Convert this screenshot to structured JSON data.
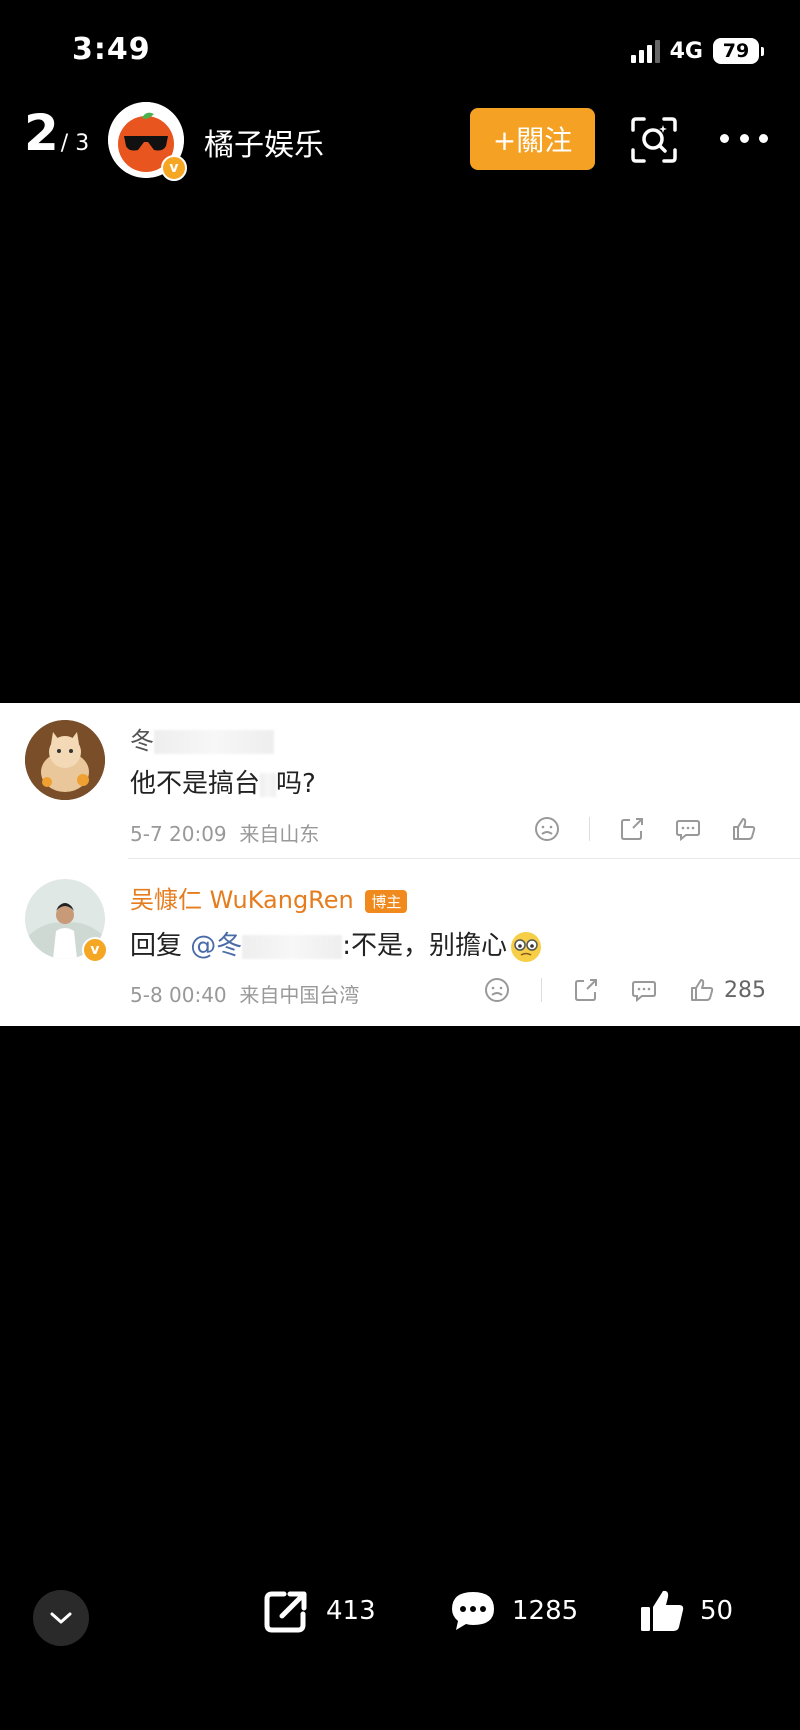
{
  "status": {
    "time": "3:49",
    "network": "4G",
    "battery": "79"
  },
  "header": {
    "page_current": "2",
    "page_total": "/ 3",
    "account_name": "橘子娱乐",
    "follow_label": "+關注",
    "verify_mark": "v"
  },
  "comment": {
    "user_name": "冬",
    "text_before": "他不是搞台",
    "text_after": "吗?",
    "time": "5-7 20:09",
    "location": "来自山东"
  },
  "reply": {
    "user_name": "吴慷仁 WuKangRen",
    "author_tag": "博主",
    "prefix": "回复",
    "mention": "@冬",
    "text": ":不是，别擔心",
    "time": "5-8 00:40",
    "location": "来自中国台湾",
    "like_count": "285"
  },
  "bottom_bar": {
    "share_count": "413",
    "comment_count": "1285",
    "like_count": "50"
  },
  "colors": {
    "follow_bg": "#f5a124",
    "author_name": "#e57d1f",
    "mention": "#4a6aa8"
  }
}
